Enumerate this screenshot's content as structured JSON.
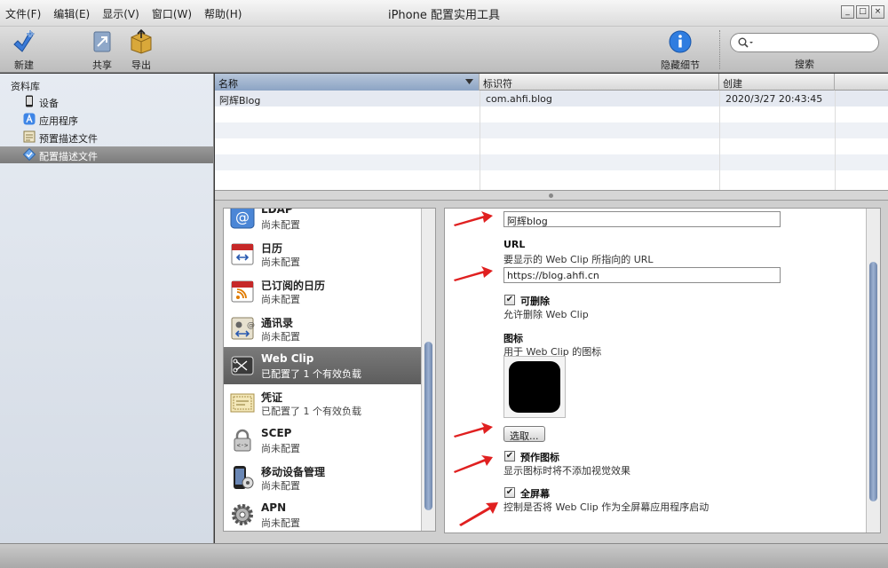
{
  "window": {
    "title": "iPhone 配置实用工具",
    "menus": [
      "文件(F)",
      "编辑(E)",
      "显示(V)",
      "窗口(W)",
      "帮助(H)"
    ],
    "controls": [
      "_",
      "□",
      "×"
    ]
  },
  "toolbar": {
    "new_label": "新建",
    "share_label": "共享",
    "export_label": "导出",
    "hide_details_label": "隐藏细节",
    "search_label": "搜索",
    "search_placeholder": ""
  },
  "sidebar": {
    "library_label": "资料库",
    "items": [
      {
        "label": "设备",
        "icon": "phone-icon"
      },
      {
        "label": "应用程序",
        "icon": "app-store-icon"
      },
      {
        "label": "预置描述文件",
        "icon": "provisioning-profile-icon"
      },
      {
        "label": "配置描述文件",
        "icon": "configuration-profile-icon",
        "selected": true
      }
    ]
  },
  "table": {
    "columns": [
      "名称",
      "标识符",
      "创建"
    ],
    "rows": [
      {
        "name": "阿辉Blog",
        "identifier": "com.ahfi.blog",
        "created": "2020/3/27 20:43:45"
      }
    ]
  },
  "payloads": [
    {
      "name": "LDAP",
      "status": "尚未配置",
      "icon": "ldap-icon"
    },
    {
      "name": "日历",
      "status": "尚未配置",
      "icon": "calendar-icon"
    },
    {
      "name": "已订阅的日历",
      "status": "尚未配置",
      "icon": "subscribed-calendar-icon"
    },
    {
      "name": "通讯录",
      "status": "尚未配置",
      "icon": "contacts-icon"
    },
    {
      "name": "Web Clip",
      "status": "已配置了 1 个有效负载",
      "icon": "web-clip-icon",
      "selected": true
    },
    {
      "name": "凭证",
      "status": "已配置了 1 个有效负载",
      "icon": "certificate-icon"
    },
    {
      "name": "SCEP",
      "status": "尚未配置",
      "icon": "scep-icon"
    },
    {
      "name": "移动设备管理",
      "status": "尚未配置",
      "icon": "mdm-icon"
    },
    {
      "name": "APN",
      "status": "尚未配置",
      "icon": "apn-icon"
    }
  ],
  "webclip": {
    "label_value": "阿辉blog",
    "url_title": "URL",
    "url_desc": "要显示的 Web Clip 所指向的 URL",
    "url_value": "https://blog.ahfi.cn",
    "removable_label": "可删除",
    "removable_desc": "允许删除 Web Clip",
    "removable_checked": true,
    "icon_title": "图标",
    "icon_desc": "用于 Web Clip 的图标",
    "choose_button": "选取...",
    "precomposed_label": "预作图标",
    "precomposed_desc": "显示图标时将不添加视觉效果",
    "precomposed_checked": true,
    "fullscreen_label": "全屏幕",
    "fullscreen_desc": "控制是否将 Web Clip 作为全屏幕应用程序启动",
    "fullscreen_checked": true,
    "check_mark": "✔"
  },
  "colors": {
    "selection_blue": "#8ca4c4",
    "arrow_red": "#e02020",
    "scroll_thumb": "#7f96bb"
  }
}
